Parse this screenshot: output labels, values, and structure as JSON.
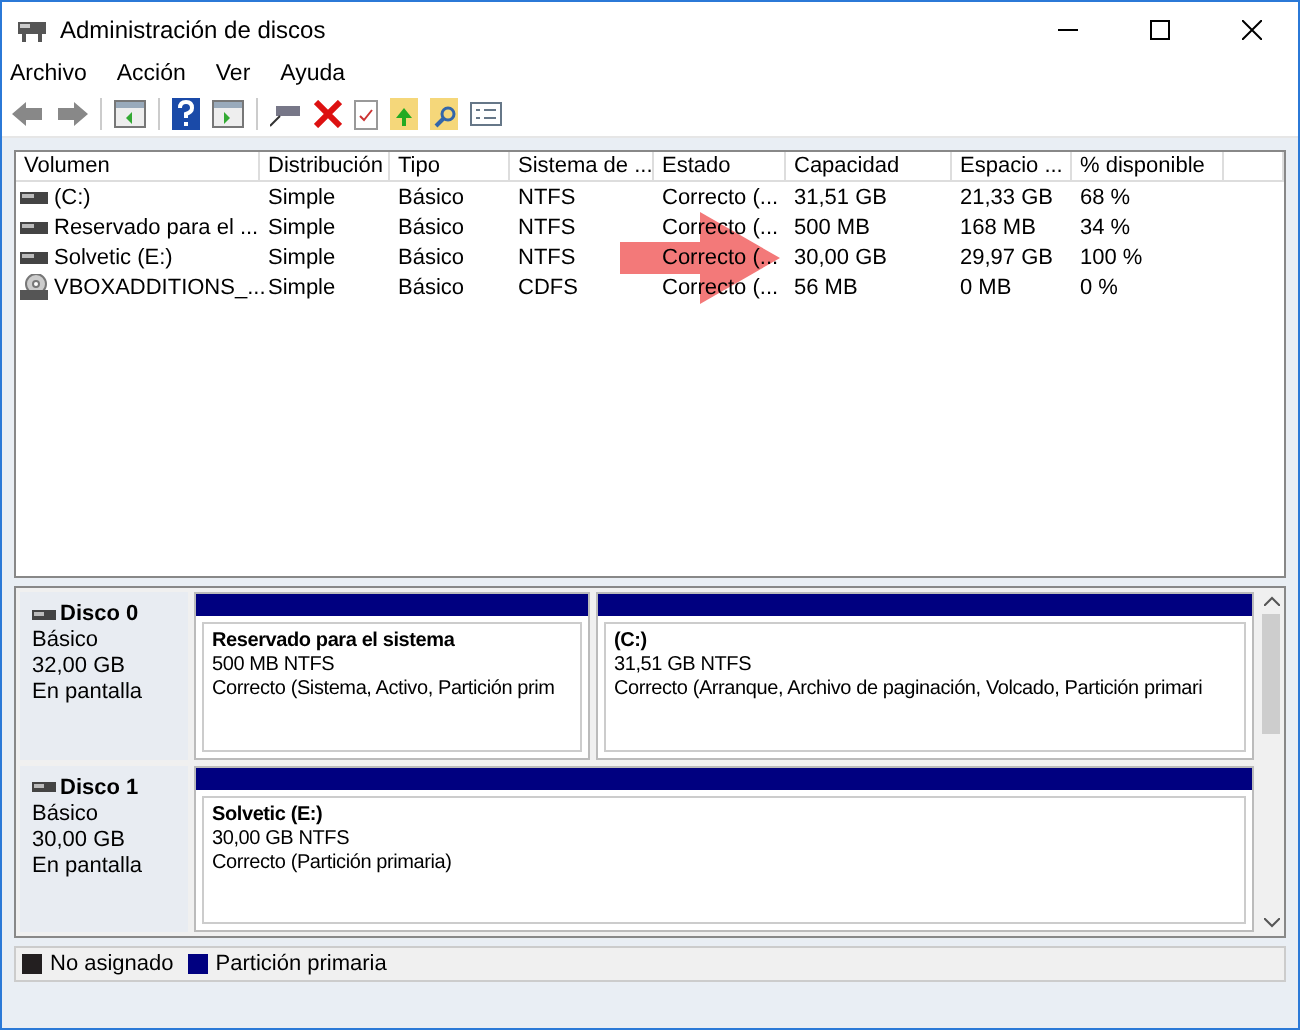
{
  "window": {
    "title": "Administración de discos"
  },
  "menu": [
    "Archivo",
    "Acción",
    "Ver",
    "Ayuda"
  ],
  "table": {
    "columns": [
      "Volumen",
      "Distribución",
      "Tipo",
      "Sistema de ...",
      "Estado",
      "Capacidad",
      "Espacio ...",
      "% disponible"
    ],
    "rows": [
      {
        "kind": "disk",
        "highlighted": false,
        "cells": [
          "(C:)",
          "Simple",
          "Básico",
          "NTFS",
          "Correcto (...",
          "31,51 GB",
          "21,33 GB",
          "68 %"
        ]
      },
      {
        "kind": "disk",
        "highlighted": false,
        "cells": [
          "Reservado para el ...",
          "Simple",
          "Básico",
          "NTFS",
          "Correcto (...",
          "500 MB",
          "168 MB",
          "34 %"
        ]
      },
      {
        "kind": "disk",
        "highlighted": true,
        "cells": [
          "Solvetic (E:)",
          "Simple",
          "Básico",
          "NTFS",
          "Correcto (...",
          "30,00 GB",
          "29,97 GB",
          "100 %"
        ]
      },
      {
        "kind": "cdrom",
        "highlighted": false,
        "cells": [
          "VBOXADDITIONS_...",
          "Simple",
          "Básico",
          "CDFS",
          "Correcto (...",
          "56 MB",
          "0 MB",
          "0 %"
        ]
      }
    ]
  },
  "disks": [
    {
      "name": "Disco 0",
      "type": "Básico",
      "size": "32,00 GB",
      "status": "En pantalla",
      "partitions": [
        {
          "name": "Reservado para el sistema",
          "info": "500 MB NTFS",
          "status": "Correcto (Sistema, Activo, Partición prim"
        },
        {
          "name": "(C:)",
          "info": "31,51 GB NTFS",
          "status": "Correcto (Arranque, Archivo de paginación, Volcado, Partición primari"
        }
      ]
    },
    {
      "name": "Disco 1",
      "type": "Básico",
      "size": "30,00 GB",
      "status": "En pantalla",
      "partitions": [
        {
          "name": "Solvetic  (E:)",
          "info": "30,00 GB NTFS",
          "status": "Correcto (Partición primaria)"
        }
      ]
    }
  ],
  "legend": [
    {
      "label": "No asignado",
      "color": "#231f20"
    },
    {
      "label": "Partición primaria",
      "color": "#000080"
    }
  ]
}
